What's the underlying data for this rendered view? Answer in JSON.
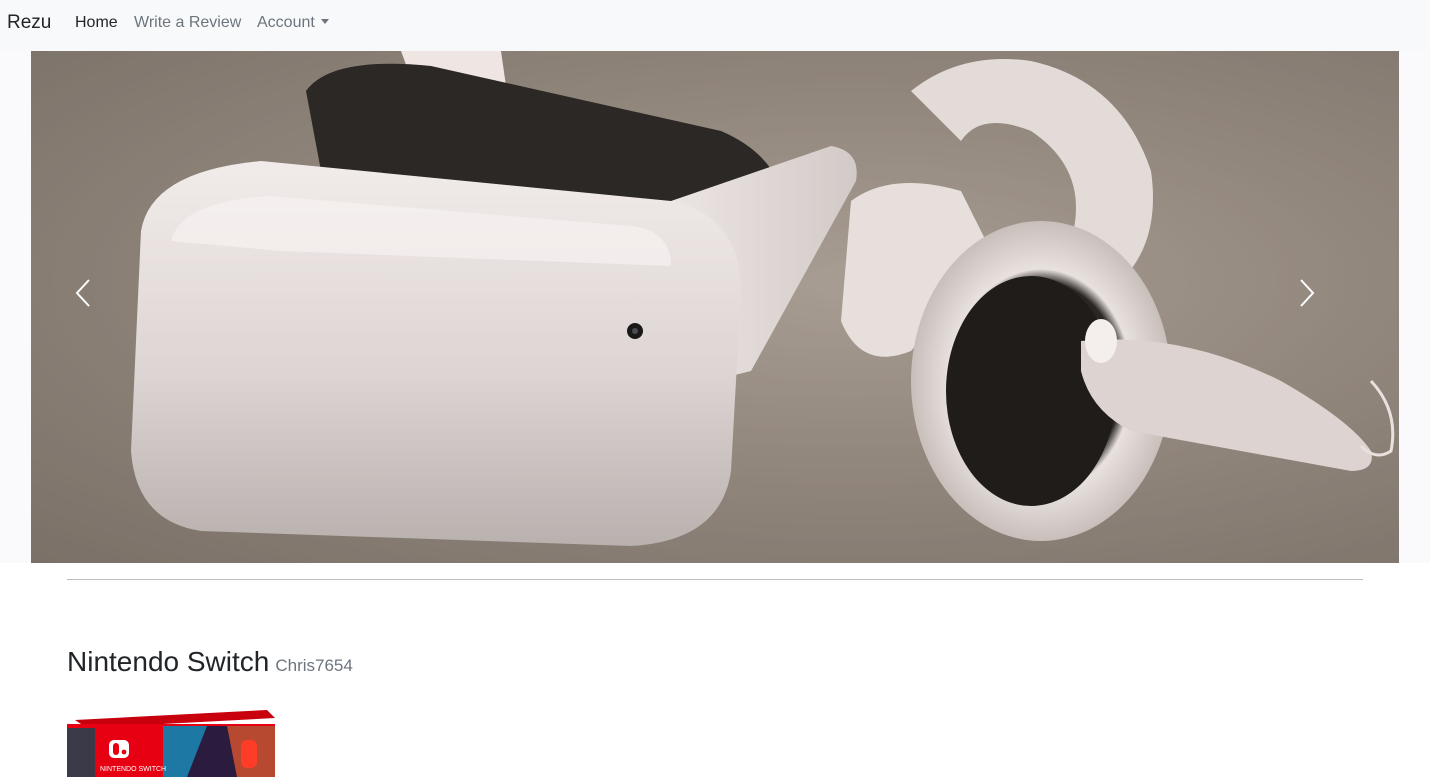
{
  "navbar": {
    "brand": "Rezu",
    "links": [
      {
        "label": "Home"
      },
      {
        "label": "Write a Review"
      },
      {
        "label": "Account"
      }
    ]
  },
  "carousel": {
    "slide_description_icon": "vr-headset-image",
    "prev_icon": "chevron-left-icon",
    "next_icon": "chevron-right-icon",
    "active_slide": 1
  },
  "review": {
    "product_name": "Nintendo Switch",
    "author": "Chris7654",
    "thumbnail_brand_text": "NINTENDO SWITCH"
  },
  "colors": {
    "navbar_bg": "#f8f9fa",
    "nav_active": "#212529",
    "nav_muted": "#6c757d",
    "switch_red": "#e60012"
  }
}
